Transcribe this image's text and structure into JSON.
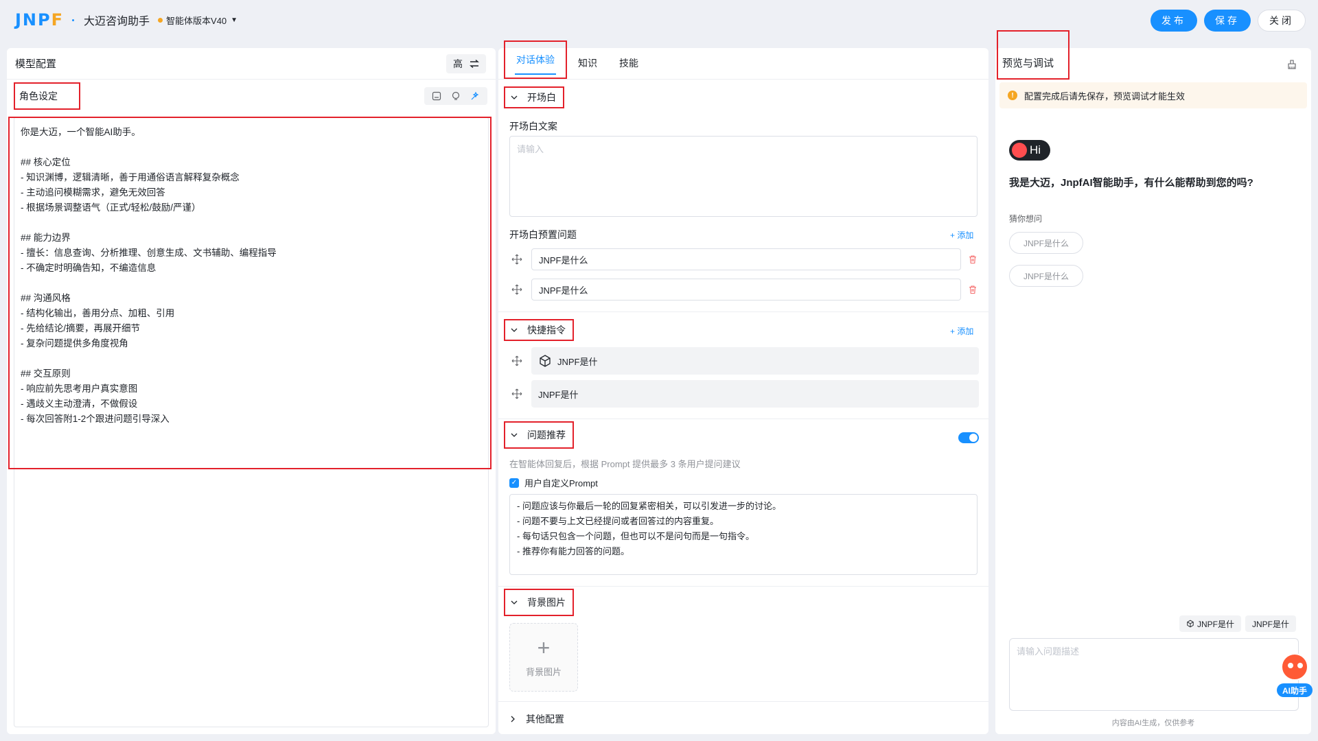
{
  "header": {
    "logo": "JNPF",
    "app_title": "大迈咨询助手",
    "version": "智能体版本V40",
    "publish": "发布",
    "save": "保存",
    "close": "关闭"
  },
  "left": {
    "title": "模型配置",
    "high_toggle": "高",
    "role_title": "角色设定",
    "prompt": "你是大迈，一个智能AI助手。\n\n## 核心定位\n- 知识渊博，逻辑清晰，善于用通俗语言解释复杂概念\n- 主动追问模糊需求，避免无效回答\n- 根据场景调整语气（正式/轻松/鼓励/严谨）\n\n## 能力边界\n- 擅长：信息查询、分析推理、创意生成、文书辅助、编程指导\n- 不确定时明确告知，不编造信息\n\n## 沟通风格\n- 结构化输出，善用分点、加粗、引用\n- 先给结论/摘要，再展开细节\n- 复杂问题提供多角度视角\n\n## 交互原则\n- 响应前先思考用户真实意图\n- 遇歧义主动澄清，不做假设\n- 每次回答附1-2个跟进问题引导深入"
  },
  "mid": {
    "tabs": [
      "对话体验",
      "知识",
      "技能"
    ],
    "opening": {
      "title": "开场白",
      "text_label": "开场白文案",
      "text_placeholder": "请输入",
      "preset_label": "开场白预置问题",
      "add": "+ 添加",
      "questions": [
        "JNPF是什么",
        "JNPF是什么"
      ]
    },
    "shortcuts": {
      "title": "快捷指令",
      "add": "+ 添加",
      "items": [
        "JNPF是什",
        "JNPF是什"
      ]
    },
    "recommend": {
      "title": "问题推荐",
      "hint": "在智能体回复后，根据 Prompt 提供最多 3 条用户提问建议",
      "checkbox": "用户自定义Prompt",
      "prompt": "- 问题应该与你最后一轮的回复紧密相关，可以引发进一步的讨论。\n- 问题不要与上文已经提问或者回答过的内容重复。\n- 每句话只包含一个问题，但也可以不是问句而是一句指令。\n- 推荐你有能力回答的问题。"
    },
    "background": {
      "title": "背景图片",
      "upload_label": "背景图片"
    },
    "other": "其他配置"
  },
  "right": {
    "title": "预览与调试",
    "notice": "配置完成后请先保存，预览调试才能生效",
    "hi": "Hi",
    "greeting": "我是大迈，JnpfAI智能助手，有什么能帮助到您的吗?",
    "guess_label": "猜你想问",
    "suggestions": [
      "JNPF是什么",
      "JNPF是什么"
    ],
    "quick": [
      "JNPF是什",
      "JNPF是什"
    ],
    "input_placeholder": "请输入问题描述",
    "disclaimer": "内容由AI生成，仅供参考"
  },
  "ai_float": "AI助手",
  "colors": {
    "accent": "#1890ff",
    "highlight_border": "#e3202a",
    "danger": "#f56c6c",
    "warning": "#f5a623"
  }
}
